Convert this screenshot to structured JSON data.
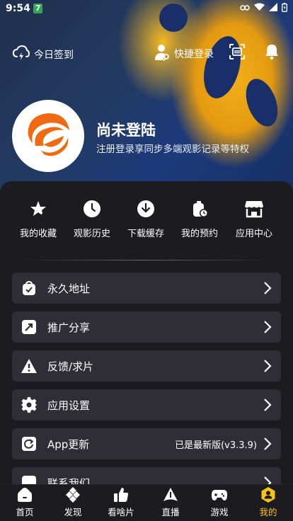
{
  "status_bar": {
    "time": "9:54",
    "badge": "7"
  },
  "header": {
    "checkin_label": "今日签到",
    "quick_login_label": "快捷登录"
  },
  "profile": {
    "username": "尚未登陆",
    "subtitle": "注册登录享同步多端观影记录等特权"
  },
  "shortcuts": [
    {
      "label": "我的收藏",
      "icon": "star-icon"
    },
    {
      "label": "观影历史",
      "icon": "clock-icon"
    },
    {
      "label": "下载缓存",
      "icon": "download-icon"
    },
    {
      "label": "我的预约",
      "icon": "reservation-icon"
    },
    {
      "label": "应用中心",
      "icon": "store-icon"
    }
  ],
  "menu": [
    {
      "label": "永久地址",
      "icon": "lock-bag-icon"
    },
    {
      "label": "推广分享",
      "icon": "share-icon"
    },
    {
      "label": "反馈/求片",
      "icon": "warning-icon"
    },
    {
      "label": "应用设置",
      "icon": "gear-icon"
    },
    {
      "label": "App更新",
      "icon": "refresh-icon",
      "value": "已是最新版(v3.3.9)"
    },
    {
      "label": "联系我们",
      "icon": "contact-icon"
    }
  ],
  "tabs": [
    {
      "label": "首页",
      "icon": "home-icon"
    },
    {
      "label": "发现",
      "icon": "discover-icon"
    },
    {
      "label": "看啥片",
      "icon": "thumbs-up-icon"
    },
    {
      "label": "直播",
      "icon": "live-icon"
    },
    {
      "label": "游戏",
      "icon": "gamepad-icon"
    },
    {
      "label": "我的",
      "icon": "profile-icon",
      "active": true
    }
  ],
  "colors": {
    "accent": "#f4c21a",
    "brand_orange": "#f06a12",
    "panel": "#1c1c20",
    "row": "#2e2e34"
  }
}
